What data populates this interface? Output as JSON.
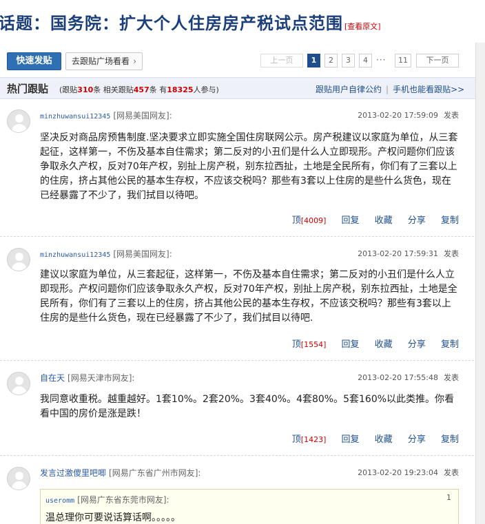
{
  "header": {
    "title": "话题：国务院：扩大个人住房房产税试点范围",
    "view_original": "[查看原文]"
  },
  "toolbar": {
    "post_button": "快速发贴",
    "plaza_button": "去跟贴广场看看",
    "pager": {
      "prev": "上一页",
      "pages": [
        "1",
        "2",
        "3",
        "4"
      ],
      "dots": "···",
      "last": "11",
      "next": "下一页",
      "current": "1"
    }
  },
  "hot": {
    "title": "热门跟贴",
    "stats": {
      "lead1": "(跟贴",
      "reply_count": "310",
      "unit1": "条 相关跟贴",
      "related_count": "457",
      "unit2": "条 有",
      "participants": "18325",
      "unit3": "人参与)"
    },
    "link_rules": "跟贴用户自律公约",
    "link_mobile": "手机也能看跟贴>>",
    "separator": "|"
  },
  "posts": [
    {
      "author": "minzhuwansui12345",
      "source": "[网易美国网友]:",
      "time": "2013-02-20  17:59:09",
      "time_label": "发表",
      "content": "坚决反对商品房预售制度.坚决要求立即实施全国住房联网公示。房产税建议以家庭为单位，从三套起征，这样第一，不伤及基本自住需求；第二反对的小丑们是什么人立即现形。产权问题你们应该争取永久产权，反对70年产权，别扯上房产税，别东拉西扯，土地是全民所有，你们有了三套以上的住房，挤占其他公民的基本生存权，不应该交税吗？那些有3套以上住房的是些什么货色，现在已经暴露了不少了，我们拭目以待吧。",
      "up": "顶",
      "up_count": "[4009]",
      "reply": "回复",
      "fav": "收藏",
      "share": "分享",
      "copy": "复制"
    },
    {
      "author": "minzhuwansui12345",
      "source": "[网易美国网友]:",
      "time": "2013-02-20  17:59:31",
      "time_label": "发表",
      "content": "建议以家庭为单位，从三套起征，这样第一，不伤及基本自住需求；第二反对的小丑们是什么人立即现形。产权问题你们应该争取永久产权，反对70年产权，别扯上房产税，别东拉西扯，土地是全民所有，你们有了三套以上的住房，挤占其他公民的基本生存权，不应该交税吗？那些有3套以上住房的是些什么货色，现在已经暴露了不少了，我们拭目以待吧.",
      "up": "顶",
      "up_count": "[1554]",
      "reply": "回复",
      "fav": "收藏",
      "share": "分享",
      "copy": "复制"
    },
    {
      "author": "自在天",
      "source": "[网易天津市网友]:",
      "time": "2013-02-20  17:55:48",
      "time_label": "发表",
      "content": "我同意收重税。越重越好。1套10%。2套20%。3套40%。4套80%。5套160%以此类推。你看看中国的房价是涨是跌！",
      "up": "顶",
      "up_count": "[1423]",
      "reply": "回复",
      "fav": "收藏",
      "share": "分享",
      "copy": "复制"
    },
    {
      "author": "发言过激傻里吧唧",
      "source": "[网易广东省广州市网友]:",
      "time": "2013-02-20  19:23:04",
      "time_label": "发表",
      "quote": {
        "author": "useromm",
        "source": "[网易广东省东莞市网友]:",
        "floor": "1",
        "text": "温总理你可要说话算话啊。。。。。"
      }
    }
  ]
}
